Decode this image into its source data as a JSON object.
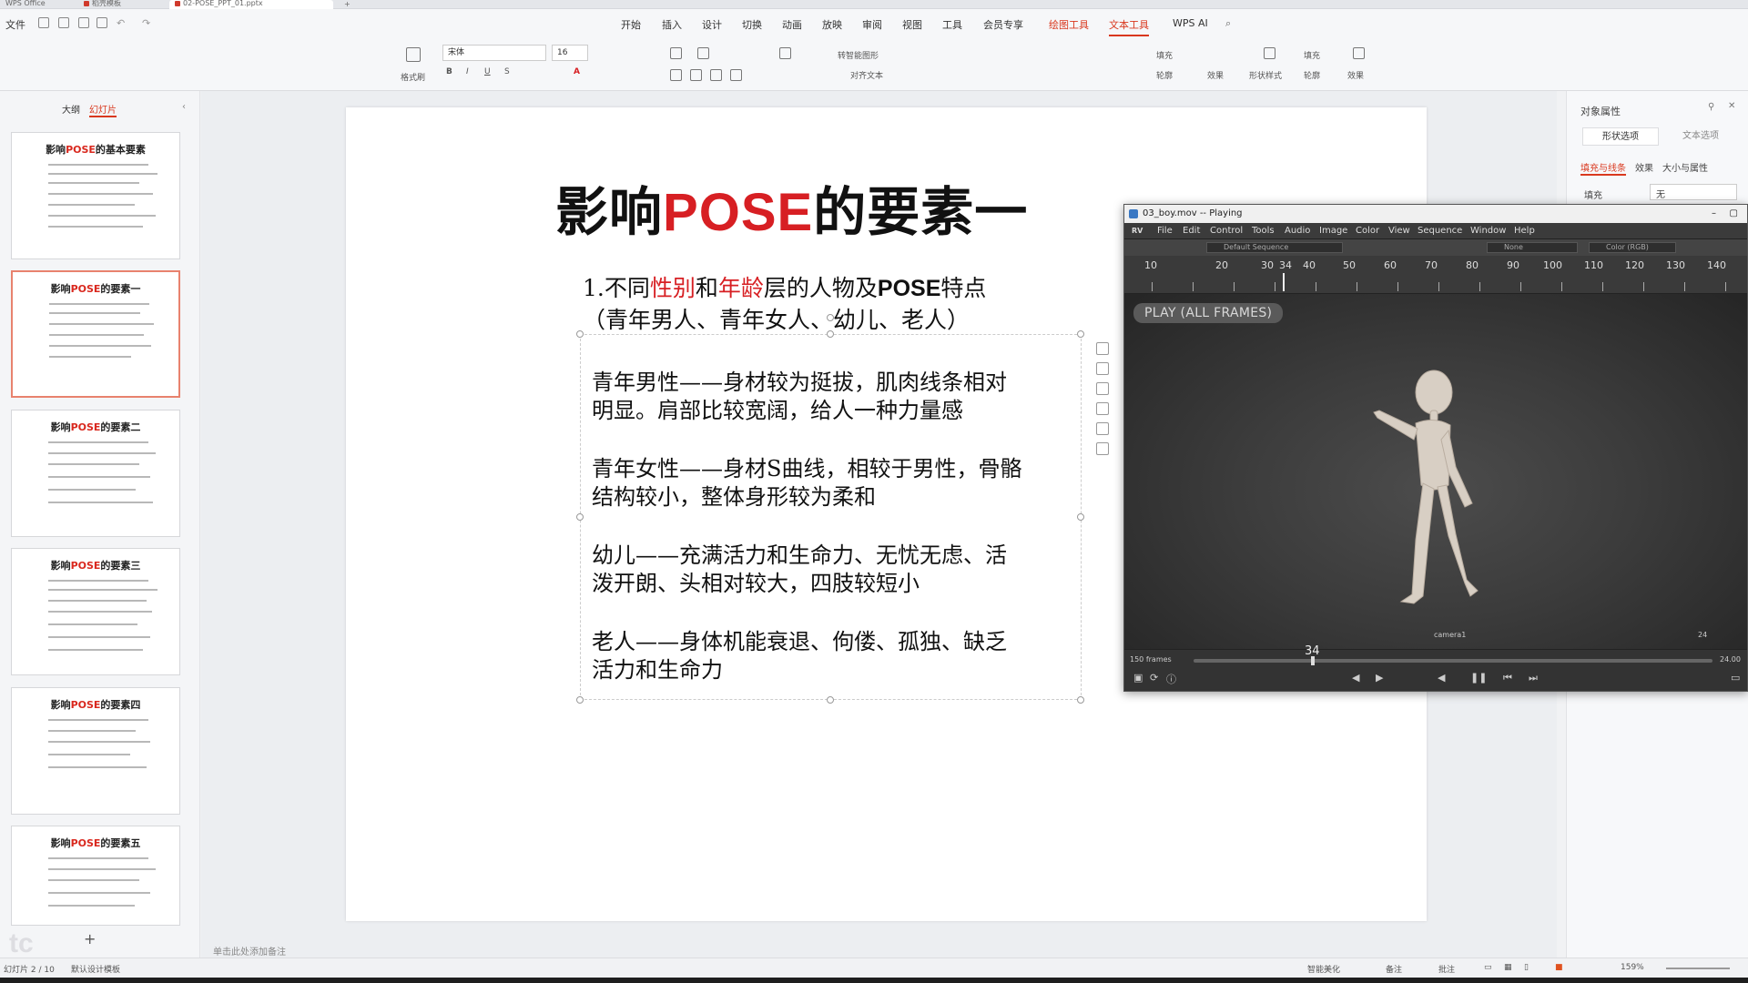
{
  "tabs": [
    {
      "label": "WPS Office"
    },
    {
      "label": "稻壳模板"
    },
    {
      "label": "02-POSE_PPT_01.pptx"
    }
  ],
  "menu": {
    "file": "文件",
    "items": [
      "开始",
      "插入",
      "设计",
      "切换",
      "动画",
      "放映",
      "审阅",
      "视图",
      "工具",
      "会员专享"
    ],
    "drawing_tools": "绘图工具",
    "text_tools": "文本工具",
    "wps_ai": "WPS AI"
  },
  "ribbon": {
    "format_painter": "格式刷",
    "font_name": "宋体",
    "font_size": "16",
    "convert_smartart": "转智能图形",
    "align_text": "对齐文本",
    "fill": "填充",
    "outline": "轮廓",
    "effect": "效果",
    "shape_style": "形状样式",
    "shape_fill": "填充",
    "shape_outline": "轮廓",
    "shape_effect": "效果"
  },
  "left_panel": {
    "tab_outline": "大纲",
    "tab_slides": "幻灯片",
    "slides": [
      {
        "title_pre": "影响",
        "title_pose": "POSE",
        "title_post": "的基本要素"
      },
      {
        "title_pre": "影响",
        "title_pose": "POSE",
        "title_post": "的要素一"
      },
      {
        "title_pre": "影响",
        "title_pose": "POSE",
        "title_post": "的要素二"
      },
      {
        "title_pre": "影响",
        "title_pose": "POSE",
        "title_post": "的要素三"
      },
      {
        "title_pre": "影响",
        "title_pose": "POSE",
        "title_post": "的要素四"
      },
      {
        "title_pre": "影响",
        "title_pose": "POSE",
        "title_post": "的要素五"
      }
    ],
    "add_slide": "+"
  },
  "slide": {
    "title_pre": "影响",
    "title_pose": "POSE",
    "title_post": "的要素一",
    "subtitle_a": "1.不同",
    "subtitle_gender": "性别",
    "subtitle_and": "和",
    "subtitle_age": "年龄",
    "subtitle_b": "层的人物及",
    "subtitle_pose": "POSE",
    "subtitle_c": "特点",
    "subtitle_line2": "（青年男人、青年女人、幼儿、老人）",
    "paragraphs": [
      [
        "青年男性——身材较为挺拔，肌肉线条相对",
        "明显。肩部比较宽阔，给人一种力量感"
      ],
      [
        "青年女性——身材S曲线，相较于男性，骨骼",
        "结构较小，整体身形较为柔和"
      ],
      [
        "幼儿——充满活力和生命力、无忧无虑、活",
        "泼开朗、头相对较大，四肢较短小"
      ],
      [
        "老人——身体机能衰退、佝偻、孤独、缺乏",
        "活力和生命力"
      ]
    ]
  },
  "notes_hint": "单击此处添加备注",
  "right_panel": {
    "title": "对象属性",
    "tab_shape": "形状选项",
    "tab_text": "文本选项",
    "sub_fill_line": "填充与线条",
    "sub_effect": "效果",
    "sub_size": "大小与属性",
    "fill_label": "填充",
    "fill_value": "无"
  },
  "status": {
    "slide_counter": "幻灯片 2 / 10",
    "theme": "默认设计模板",
    "smart_beautify": "智能美化",
    "notes": "备注",
    "comments": "批注",
    "zoom": "159%"
  },
  "player": {
    "title": "03_boy.mov -- Playing",
    "menu": [
      "File",
      "Edit",
      "Control",
      "Tools",
      "Audio",
      "Image",
      "Color",
      "View",
      "Sequence",
      "Window",
      "Help"
    ],
    "sequence_field": "Default Sequence",
    "channel_field": "None",
    "color_field": "Color (RGB)",
    "ruler_labels": [
      "10",
      "20",
      "30",
      "34",
      "40",
      "50",
      "60",
      "70",
      "80",
      "90",
      "100",
      "110",
      "120",
      "130",
      "140"
    ],
    "badge": "PLAY (ALL FRAMES)",
    "camera": "camera1",
    "view_num": "24",
    "frames_label": "150 frames",
    "current_frame": "34",
    "time_label": "24.00",
    "progress": 0.227
  },
  "colors": {
    "accent": "#d9381e",
    "pose_red": "#d71f23"
  }
}
